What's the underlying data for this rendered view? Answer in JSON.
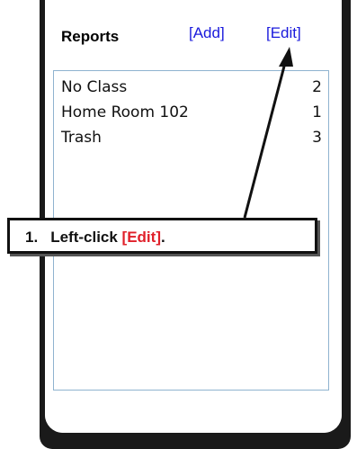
{
  "header": {
    "title": "Reports",
    "add_label": "[Add]",
    "edit_label": "[Edit]"
  },
  "list": {
    "items": [
      {
        "label": "No Class",
        "count": "2"
      },
      {
        "label": "Home Room 102",
        "count": "1"
      },
      {
        "label": "Trash",
        "count": "3"
      }
    ]
  },
  "callout": {
    "number": "1.",
    "prefix": "Left-click ",
    "highlight": "[Edit]",
    "suffix": "."
  },
  "colors": {
    "link": "#1a1adc",
    "highlight": "#e0202a",
    "list_border": "#8fb3cf"
  }
}
